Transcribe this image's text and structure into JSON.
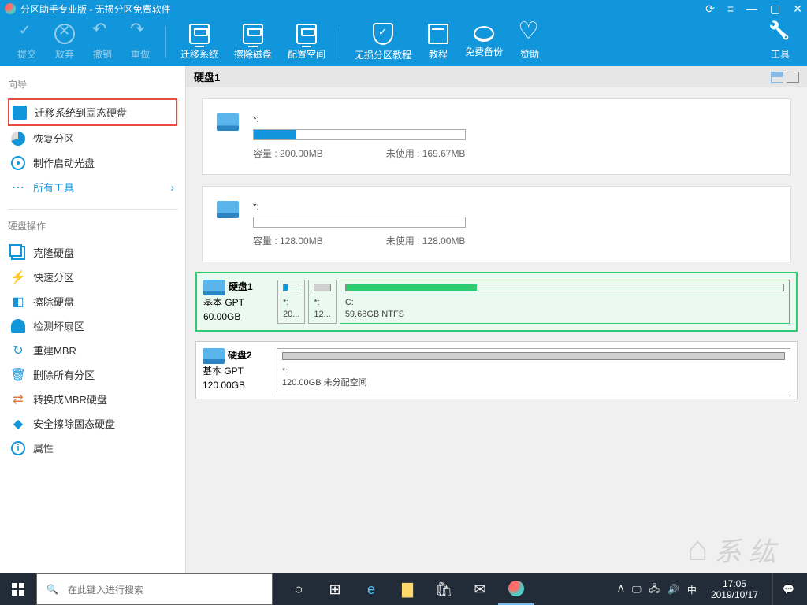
{
  "window": {
    "title": "分区助手专业版 - 无损分区免费软件"
  },
  "toolbar": {
    "commit": "提交",
    "discard": "放弃",
    "undo": "撤销",
    "redo": "重做",
    "migrate": "迁移系统",
    "wipe": "擦除磁盘",
    "allocate": "配置空间",
    "tutorial_long": "无损分区教程",
    "tutorial": "教程",
    "backup": "免费备份",
    "sponsor": "赞助",
    "tools": "工具"
  },
  "sidebar": {
    "wizard_title": "向导",
    "migrate_ssd": "迁移系统到固态硬盘",
    "recover": "恢复分区",
    "bootdisc": "制作启动光盘",
    "all_tools": "所有工具",
    "disk_ops_title": "硬盘操作",
    "clone": "克隆硬盘",
    "quick_part": "快速分区",
    "wipe": "擦除硬盘",
    "badsector": "检测坏扇区",
    "rebuild_mbr": "重建MBR",
    "delete_all": "删除所有分区",
    "to_mbr": "转换成MBR硬盘",
    "secure_erase": "安全擦除固态硬盘",
    "properties": "属性"
  },
  "main": {
    "disk1_label": "硬盘1",
    "part1": {
      "name": "*:",
      "capacity_label": "容量 : ",
      "capacity": "200.00MB",
      "unused_label": "未使用 : ",
      "unused": "169.67MB"
    },
    "part2": {
      "name": "*:",
      "capacity_label": "容量 : ",
      "capacity": "128.00MB",
      "unused_label": "未使用 : ",
      "unused": "128.00MB"
    },
    "diskrow1": {
      "name": "硬盘1",
      "type": "基本 GPT",
      "size": "60.00GB",
      "p1_label": "*:",
      "p1_size": "20...",
      "p2_label": "*:",
      "p2_size": "12...",
      "p3_label": "C:",
      "p3_size": "59.68GB NTFS"
    },
    "diskrow2": {
      "name": "硬盘2",
      "type": "基本 GPT",
      "size": "120.00GB",
      "p1_label": "*:",
      "p1_size": "120.00GB 未分配空间"
    }
  },
  "taskbar": {
    "search_placeholder": "在此键入进行搜索",
    "ime": "中",
    "time": "17:05",
    "date": "2019/10/17"
  },
  "watermark": "系 纮"
}
